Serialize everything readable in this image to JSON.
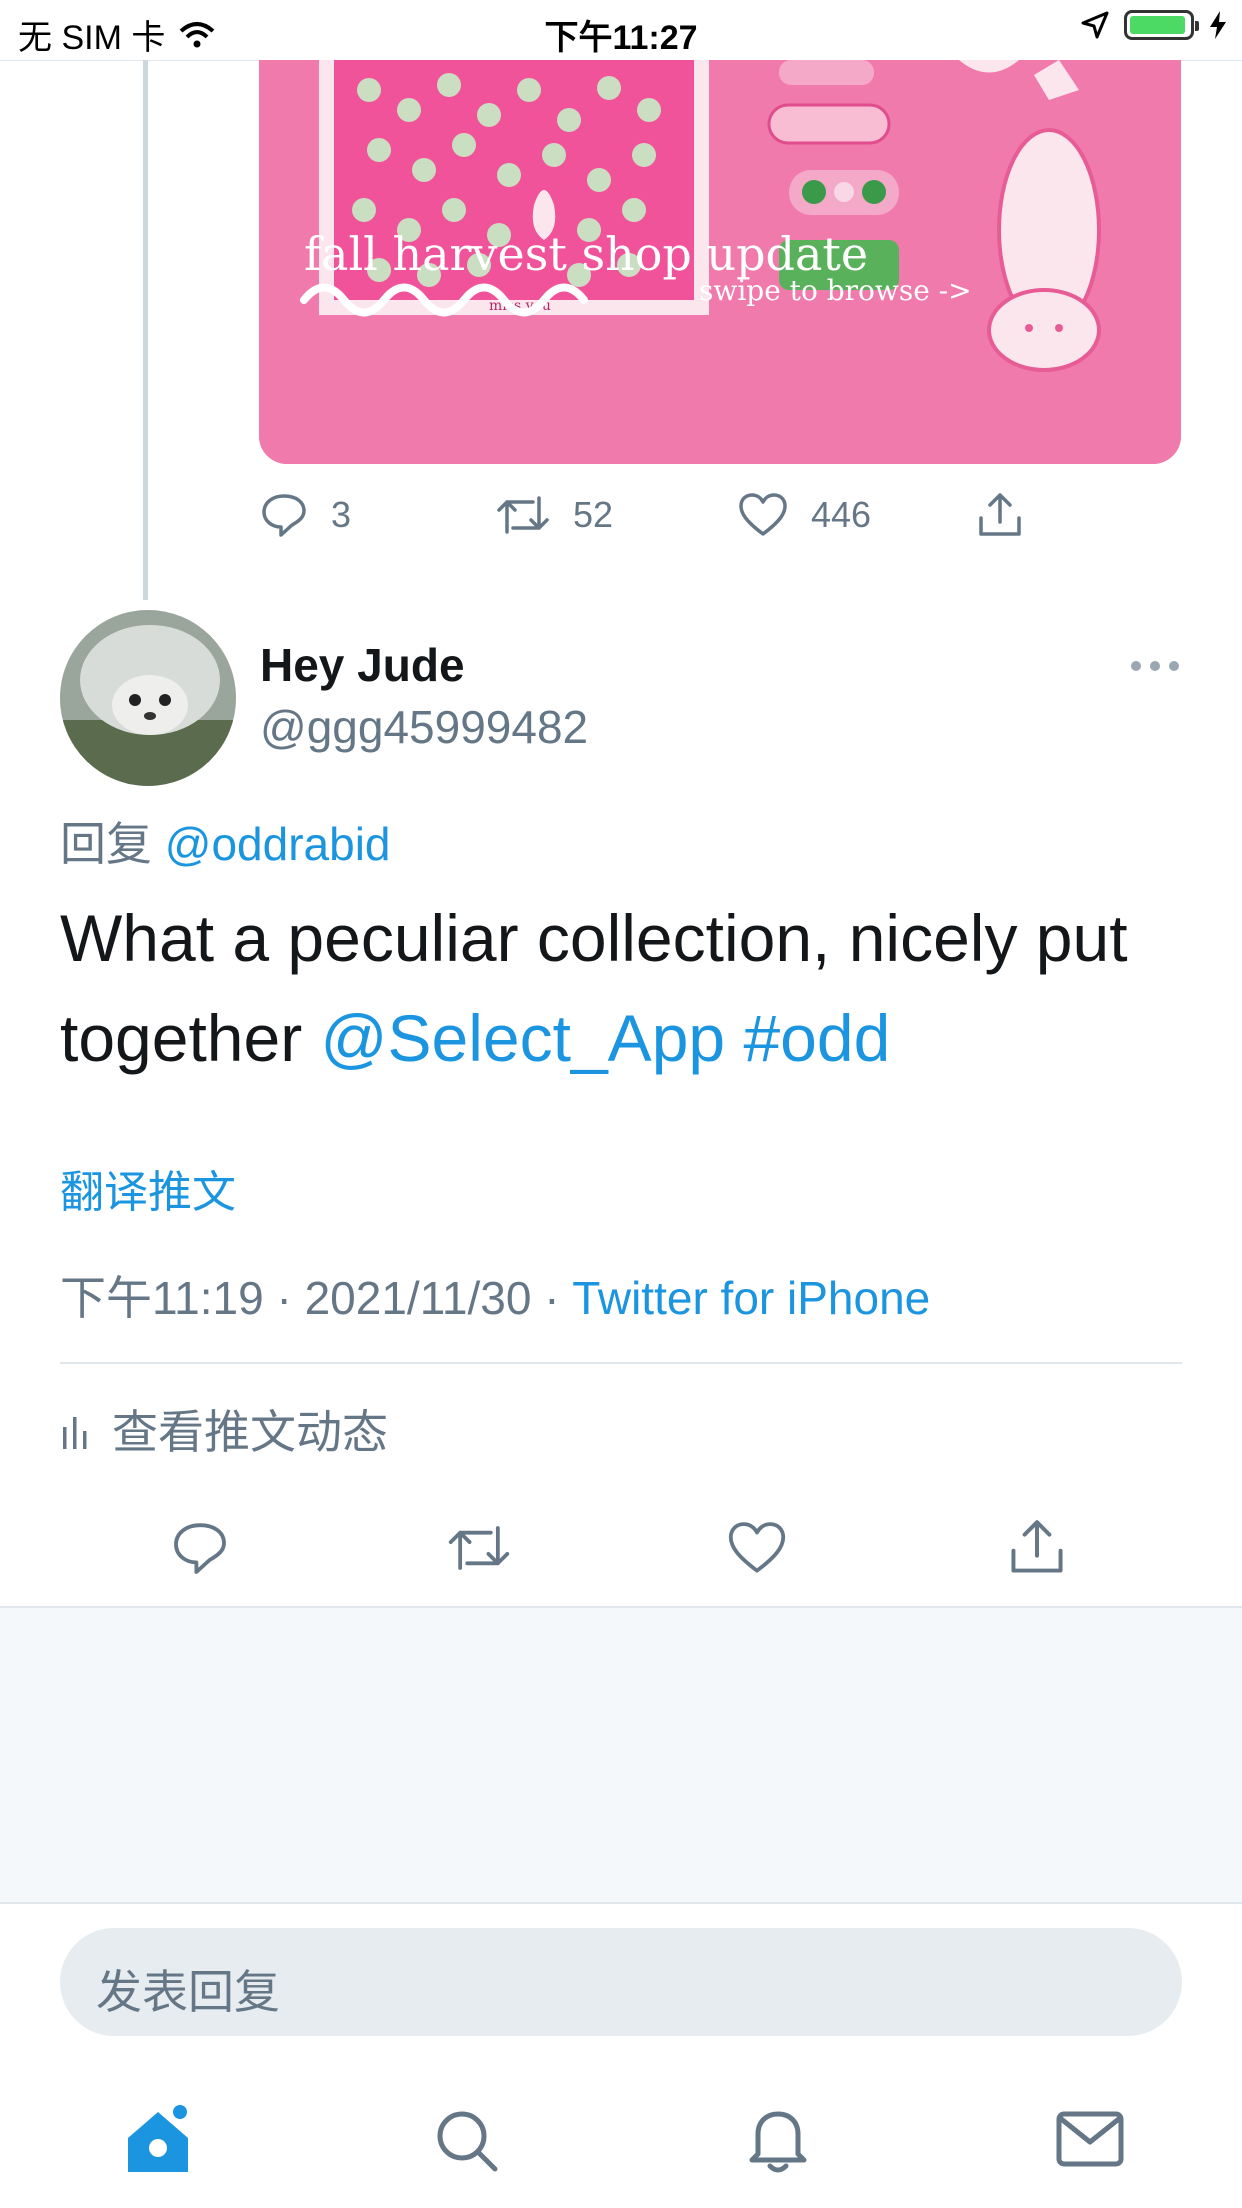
{
  "status_bar": {
    "carrier": "无 SIM 卡",
    "time": "下午11:27"
  },
  "media": {
    "caption_title": "fall harvest shop update",
    "caption_sub": "swipe to browse ->",
    "caption_small": "miss you"
  },
  "parent_actions": {
    "replies": "3",
    "retweets": "52",
    "likes": "446"
  },
  "tweet": {
    "author_name": "Hey Jude",
    "author_handle": "@ggg45999482",
    "reply_prefix": "回复",
    "reply_to": "@oddrabid",
    "text_part1": "What a peculiar collection, nicely put together ",
    "mention": "@Select_App",
    "hashtag": "#odd",
    "translate": "翻译推文",
    "time": "下午11:19",
    "date": "2021/11/30",
    "source": "Twitter for iPhone",
    "separator": "·",
    "activity": "查看推文动态"
  },
  "composer": {
    "placeholder": "发表回复"
  },
  "colors": {
    "accent": "#1b95e0",
    "secondary_text": "#657786",
    "battery": "#4cd964",
    "media_bg": "#f07aac"
  },
  "icons": {
    "tabbar": [
      "home-icon",
      "search-icon",
      "bell-icon",
      "mail-icon"
    ],
    "actions": [
      "reply-icon",
      "retweet-icon",
      "like-icon",
      "share-icon"
    ]
  }
}
